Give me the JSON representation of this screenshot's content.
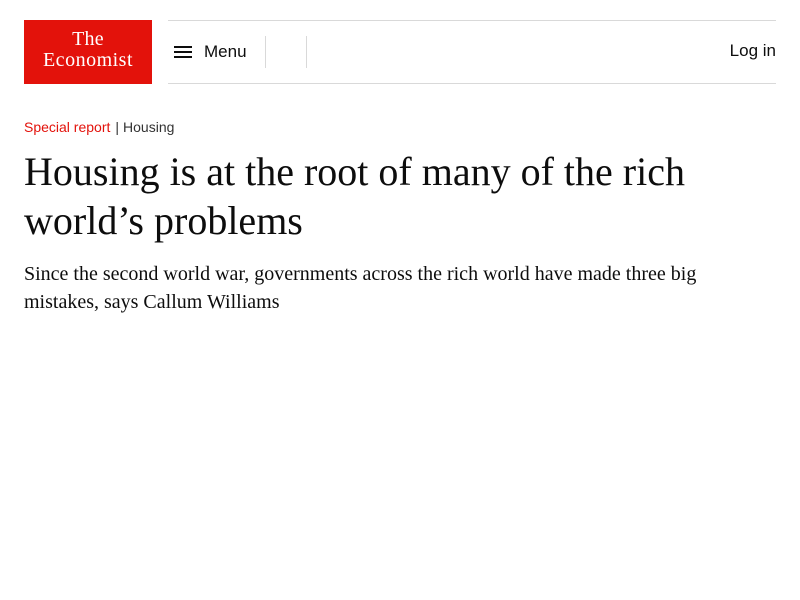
{
  "header": {
    "logo": {
      "line1": "The",
      "line2": "Economist"
    },
    "menu_label": "Menu",
    "login_label": "Log in"
  },
  "breadcrumb": {
    "section": "Special report",
    "separator": "|",
    "topic": "Housing"
  },
  "article": {
    "headline": "Housing is at the root of many of the rich world’s problems",
    "subheadline": "Since the second world war, governments across the rich world have made three big mistakes, says Callum Williams"
  },
  "colors": {
    "brand_red": "#e3120b",
    "text": "#0d0d0d",
    "divider": "#d9d9d9"
  },
  "icons": {
    "menu": "hamburger-menu-icon"
  }
}
